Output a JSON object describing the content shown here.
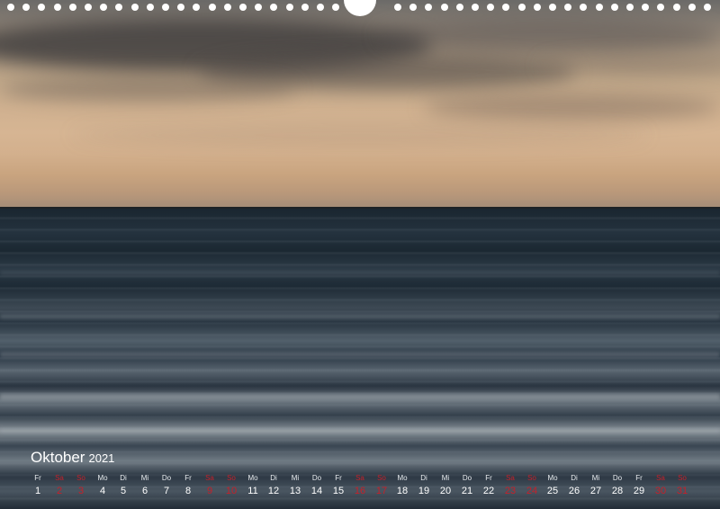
{
  "calendar": {
    "month": "Oktober",
    "year": "2021",
    "weekend_color": "#c4202a",
    "days": [
      {
        "dow": "Fr",
        "day": "1",
        "weekend": false
      },
      {
        "dow": "Sa",
        "day": "2",
        "weekend": true
      },
      {
        "dow": "So",
        "day": "3",
        "weekend": true
      },
      {
        "dow": "Mo",
        "day": "4",
        "weekend": false
      },
      {
        "dow": "Di",
        "day": "5",
        "weekend": false
      },
      {
        "dow": "Mi",
        "day": "6",
        "weekend": false
      },
      {
        "dow": "Do",
        "day": "7",
        "weekend": false
      },
      {
        "dow": "Fr",
        "day": "8",
        "weekend": false
      },
      {
        "dow": "Sa",
        "day": "9",
        "weekend": true
      },
      {
        "dow": "So",
        "day": "10",
        "weekend": true
      },
      {
        "dow": "Mo",
        "day": "11",
        "weekend": false
      },
      {
        "dow": "Di",
        "day": "12",
        "weekend": false
      },
      {
        "dow": "Mi",
        "day": "13",
        "weekend": false
      },
      {
        "dow": "Do",
        "day": "14",
        "weekend": false
      },
      {
        "dow": "Fr",
        "day": "15",
        "weekend": false
      },
      {
        "dow": "Sa",
        "day": "16",
        "weekend": true
      },
      {
        "dow": "So",
        "day": "17",
        "weekend": true
      },
      {
        "dow": "Mo",
        "day": "18",
        "weekend": false
      },
      {
        "dow": "Di",
        "day": "19",
        "weekend": false
      },
      {
        "dow": "Mi",
        "day": "20",
        "weekend": false
      },
      {
        "dow": "Do",
        "day": "21",
        "weekend": false
      },
      {
        "dow": "Fr",
        "day": "22",
        "weekend": false
      },
      {
        "dow": "Sa",
        "day": "23",
        "weekend": true
      },
      {
        "dow": "So",
        "day": "24",
        "weekend": true
      },
      {
        "dow": "Mo",
        "day": "25",
        "weekend": false
      },
      {
        "dow": "Di",
        "day": "26",
        "weekend": false
      },
      {
        "dow": "Mi",
        "day": "27",
        "weekend": false
      },
      {
        "dow": "Do",
        "day": "28",
        "weekend": false
      },
      {
        "dow": "Fr",
        "day": "29",
        "weekend": false
      },
      {
        "dow": "Sa",
        "day": "30",
        "weekend": true
      },
      {
        "dow": "So",
        "day": "31",
        "weekend": true
      }
    ]
  }
}
